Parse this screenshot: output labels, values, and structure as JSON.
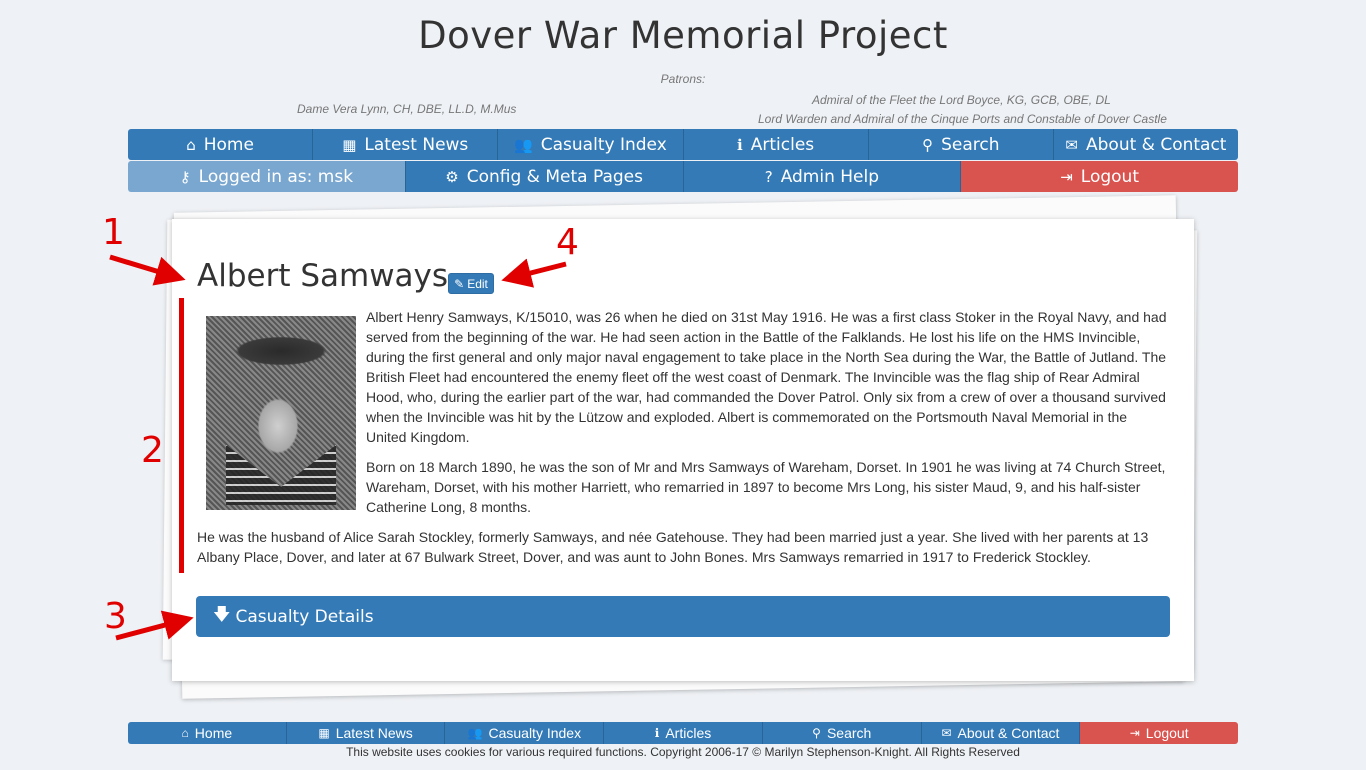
{
  "header": {
    "site_title": "Dover War Memorial Project",
    "patrons_label": "Patrons:",
    "patron_left": "Dame Vera Lynn, CH, DBE, LL.D, M.Mus",
    "patron_right_line1": "Admiral of the Fleet the Lord Boyce, KG, GCB, OBE, DL",
    "patron_right_line2": "Lord Warden and Admiral of the Cinque Ports and Constable of Dover Castle"
  },
  "nav_main": [
    {
      "label": "Home",
      "icon": "home-icon",
      "glyph": "⌂"
    },
    {
      "label": "Latest News",
      "icon": "calendar-icon",
      "glyph": "▦"
    },
    {
      "label": "Casualty Index",
      "icon": "users-icon",
      "glyph": "👥"
    },
    {
      "label": "Articles",
      "icon": "info-icon",
      "glyph": "ℹ"
    },
    {
      "label": "Search",
      "icon": "search-icon",
      "glyph": "⚲"
    },
    {
      "label": "About & Contact",
      "icon": "envelope-icon",
      "glyph": "✉"
    }
  ],
  "nav_admin": [
    {
      "label": "Logged in as: msk",
      "icon": "key-icon",
      "glyph": "⚷"
    },
    {
      "label": "Config & Meta Pages",
      "icon": "cogs-icon",
      "glyph": "⚙"
    },
    {
      "label": "Admin Help",
      "icon": "question-icon",
      "glyph": "?"
    },
    {
      "label": "Logout",
      "icon": "logout-icon",
      "glyph": "⇥"
    }
  ],
  "profile": {
    "name": "Albert Samways",
    "edit_label": "Edit",
    "bio_p1": "Albert Henry Samways, K/15010, was 26 when he died on 31st May 1916. He was a first class Stoker in the Royal Navy, and had served from the beginning of the war. He had seen action in the Battle of the Falklands.  He lost his life on the HMS Invincible, during the first general and only major naval engagement to take place in the North Sea during the War, the Battle of Jutland. The British Fleet had encountered the enemy fleet off the west coast of Denmark. The Invincible was the flag ship of Rear Admiral Hood, who, during the earlier part of the war, had commanded the Dover Patrol. Only six from a crew of over a thousand survived when the Invincible was hit by the Lützow and exploded. Albert is commemorated on the Portsmouth Naval Memorial in the United Kingdom.",
    "bio_p2": "Born on 18 March 1890, he was the son of Mr and Mrs Samways of Wareham, Dorset. In 1901 he was living at 74 Church Street, Wareham, Dorset, with his mother Harriett, who remarried in 1897 to become Mrs Long, his sister Maud, 9, and his half-sister Catherine Long, 8 months.",
    "bio_p3": "He was the husband of Alice Sarah Stockley, formerly Samways, and née Gatehouse. They had been married just a year. She lived with her parents at 13 Albany Place, Dover, and later at 67 Bulwark Street, Dover, and was aunt to John Bones. Mrs Samways remarried in 1917 to Frederick Stockley.",
    "casualty_details_label": "Casualty Details"
  },
  "annotations": {
    "n1": "1",
    "n2": "2",
    "n3": "3",
    "n4": "4",
    "color": "#e00000"
  },
  "footer_nav": [
    {
      "label": "Home",
      "icon": "home-icon",
      "glyph": "⌂"
    },
    {
      "label": "Latest News",
      "icon": "calendar-icon",
      "glyph": "▦"
    },
    {
      "label": "Casualty Index",
      "icon": "users-icon",
      "glyph": "👥"
    },
    {
      "label": "Articles",
      "icon": "info-icon",
      "glyph": "ℹ"
    },
    {
      "label": "Search",
      "icon": "search-icon",
      "glyph": "⚲"
    },
    {
      "label": "About & Contact",
      "icon": "envelope-icon",
      "glyph": "✉"
    },
    {
      "label": "Logout",
      "icon": "logout-icon",
      "glyph": "⇥"
    }
  ],
  "copyright": "This website uses cookies for various required functions. Copyright 2006-17 © Marilyn Stephenson-Knight. All Rights Reserved",
  "colors": {
    "primary": "#337ab7",
    "active": "#7aa7d0",
    "danger": "#d9534f",
    "background": "#eef1f5"
  }
}
